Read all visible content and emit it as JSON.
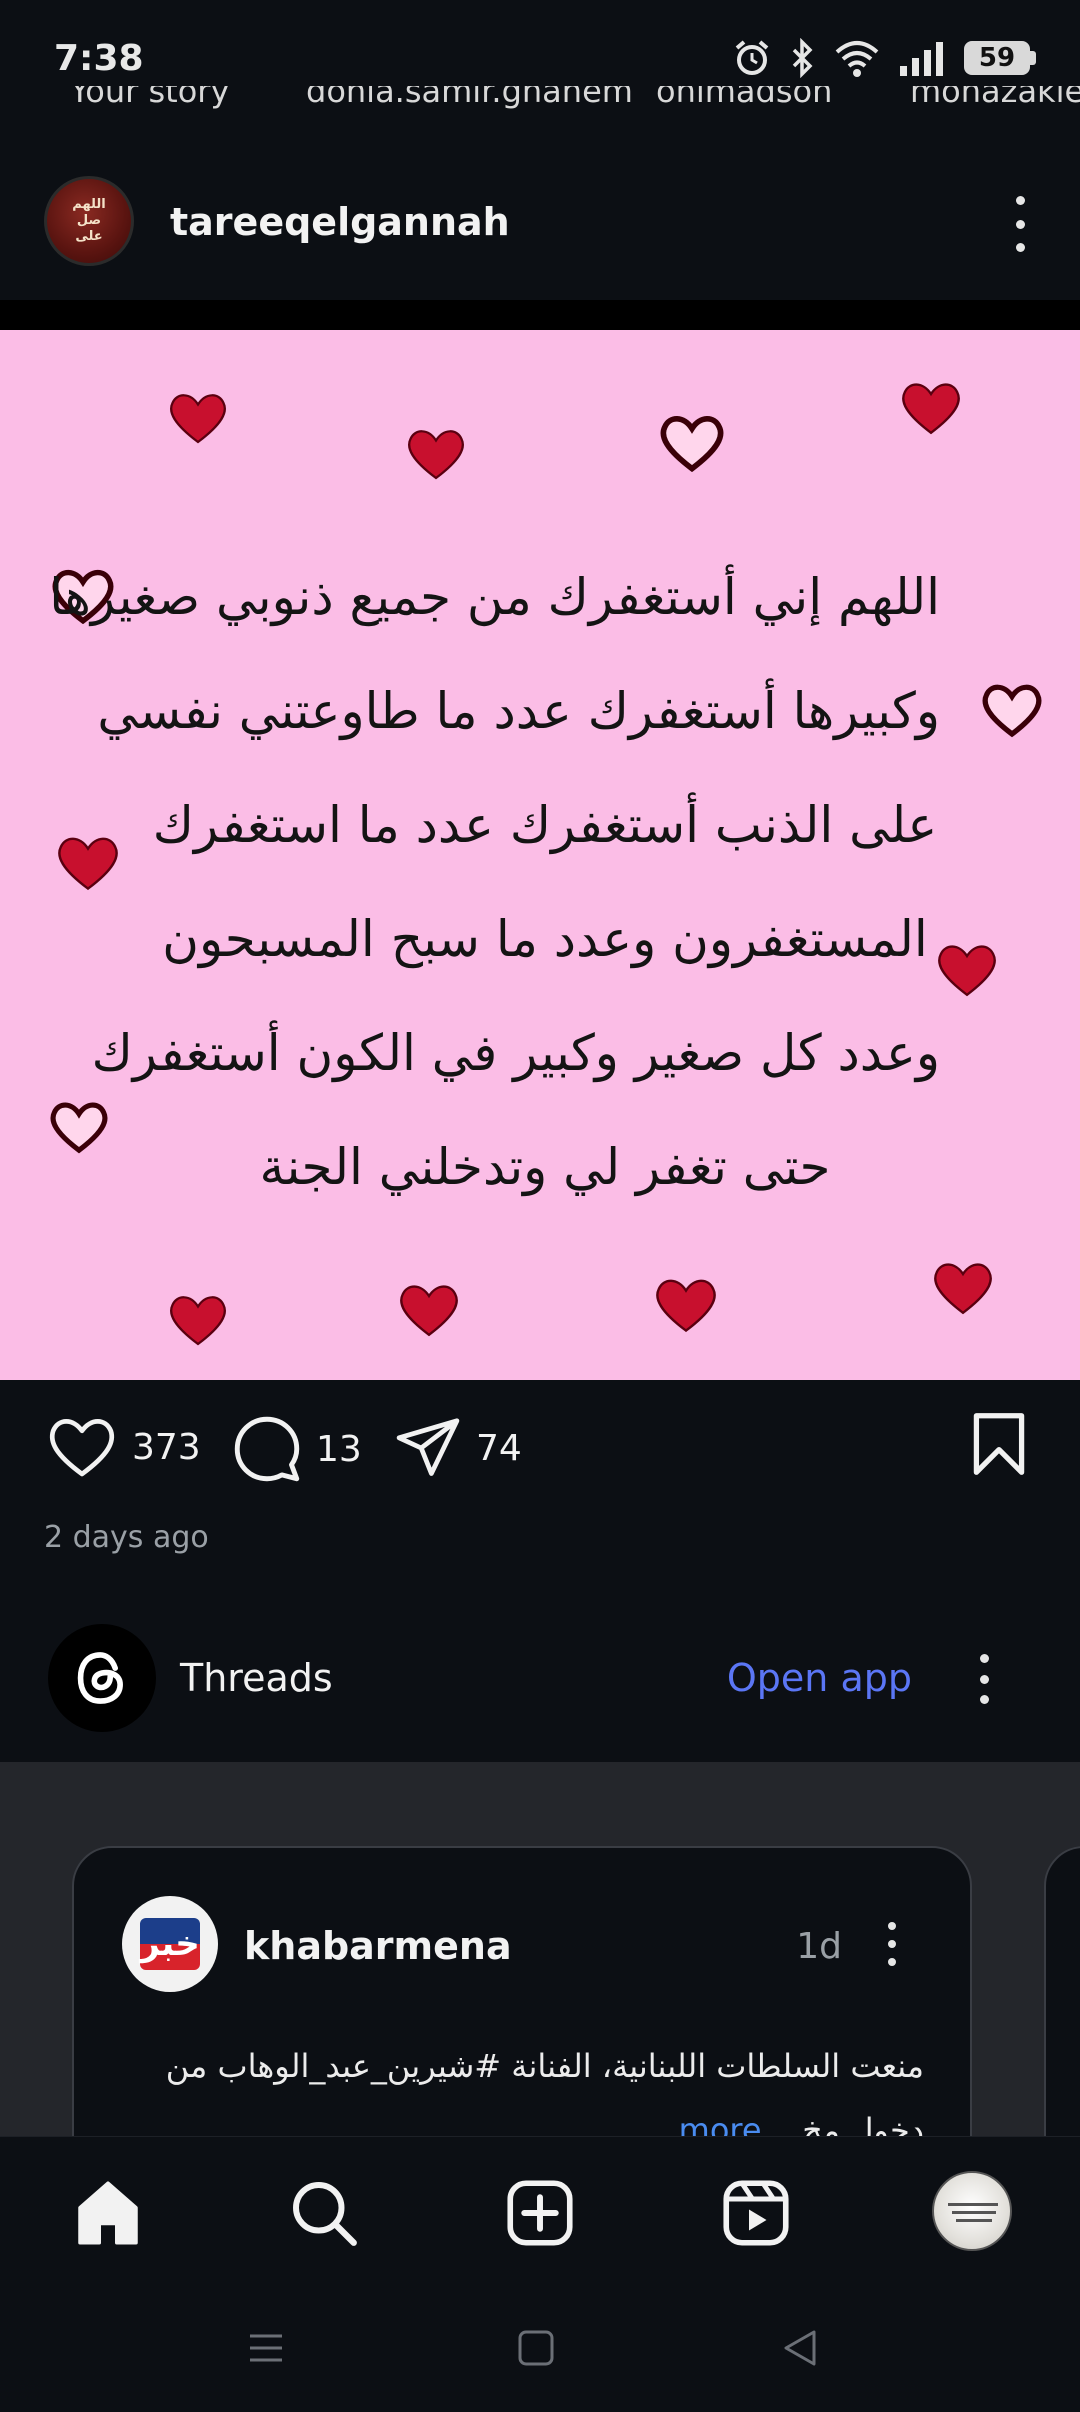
{
  "status_bar": {
    "time": "7:38",
    "battery": "59",
    "icons": [
      "alarm-icon",
      "bluetooth-icon",
      "wifi-icon",
      "signal-icon",
      "battery-icon"
    ]
  },
  "stories": [
    "Your story",
    "donia.samir.ghanem",
    "ohimadson",
    "mohazakieh"
  ],
  "post": {
    "username": "tareeqelgannah",
    "image_text_lines": [
      "اللهم إني أستغفرك من جميع ذنوبي صغيرها",
      "وكبيرها أستغفرك عدد ما طاوعتني نفسي",
      "على الذنب أستغفرك عدد ما استغفرك",
      "المستغفرون وعدد ما سبح المسبحون",
      "وعدد كل صغير وكبير في الكون أستغفرك",
      "حتى تغفر لي وتدخلني الجنة"
    ],
    "likes": "373",
    "comments": "13",
    "shares": "74",
    "time_ago": "2 days ago"
  },
  "threads": {
    "label": "Threads",
    "open_app": "Open app",
    "card": {
      "username": "khabarmena",
      "time": "1d",
      "avatar_text": "خبر",
      "text_line1": "منعت السلطات اللبنانية، الفنانة #شيرين_عبد_الوهاب من",
      "text_line2": "دخول مخ...",
      "more": "more"
    }
  },
  "colors": {
    "background": "#0c0f14",
    "post_image_bg": "#fbbde6",
    "heart_red": "#c8102e",
    "link_blue": "#5b76f5"
  },
  "bottom_nav": [
    "home-icon",
    "search-icon",
    "create-icon",
    "reels-icon",
    "profile-avatar"
  ]
}
